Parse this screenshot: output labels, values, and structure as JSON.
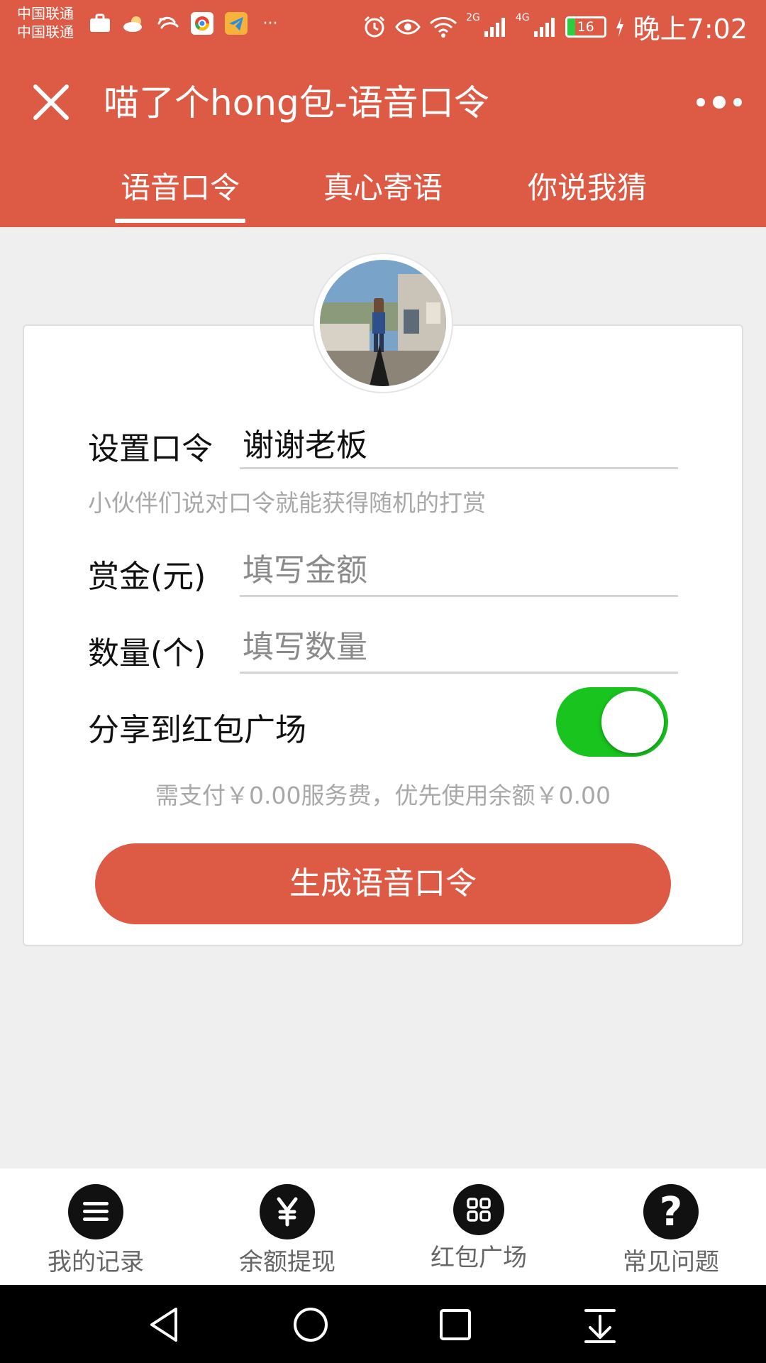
{
  "status_bar": {
    "carrier_1": "中国联通",
    "carrier_2": "中国联通",
    "more": "···",
    "network_1": "2G",
    "network_2": "4G",
    "battery": "16",
    "time": "晚上7:02"
  },
  "title_bar": {
    "title": "喵了个hong包-语音口令"
  },
  "tabs": [
    {
      "label": "语音口令",
      "active": true
    },
    {
      "label": "真心寄语",
      "active": false
    },
    {
      "label": "你说我猜",
      "active": false
    }
  ],
  "form": {
    "command_label": "设置口令",
    "command_value": "谢谢老板",
    "command_hint": "小伙伴们说对口令就能获得随机的打赏",
    "amount_label": "赏金(元)",
    "amount_placeholder": "填写金额",
    "quantity_label": "数量(个)",
    "quantity_placeholder": "填写数量",
    "share_label": "分享到红包广场",
    "share_enabled": true,
    "fee_note": "需支付￥0.00服务费，优先使用余额￥0.00",
    "submit_label": "生成语音口令"
  },
  "bottom_nav": [
    {
      "label": "我的记录",
      "icon": "list-icon"
    },
    {
      "label": "余额提现",
      "icon": "yen-icon"
    },
    {
      "label": "红包广场",
      "icon": "grid-icon"
    },
    {
      "label": "常见问题",
      "icon": "question-icon"
    }
  ],
  "colors": {
    "brand": "#dd5a45",
    "toggle_on": "#19c41e",
    "page_bg": "#efeff0"
  }
}
